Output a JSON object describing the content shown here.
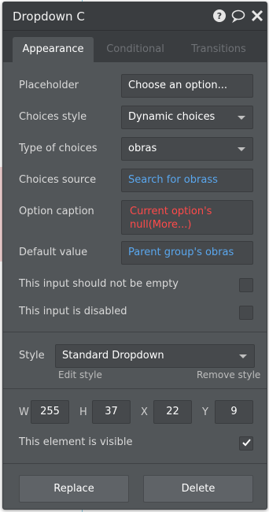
{
  "panel": {
    "title": "Dropdown C",
    "icons": [
      "help-icon",
      "comment-icon",
      "close-icon"
    ]
  },
  "tabs": [
    {
      "label": "Appearance",
      "active": true
    },
    {
      "label": "Conditional",
      "active": false
    },
    {
      "label": "Transitions",
      "active": false
    }
  ],
  "properties": {
    "placeholder": {
      "label": "Placeholder",
      "value": "Choose an option..."
    },
    "choices_style": {
      "label": "Choices style",
      "value": "Dynamic choices"
    },
    "type_of_choices": {
      "label": "Type of choices",
      "value": "obras"
    },
    "choices_source": {
      "label": "Choices source",
      "value": "Search for obrass"
    },
    "option_caption": {
      "label": "Option caption",
      "value": "Current option's null(More...)"
    },
    "default_value": {
      "label": "Default value",
      "value": "Parent group's obras"
    },
    "not_empty": {
      "label": "This input should not be empty",
      "checked": false
    },
    "disabled": {
      "label": "This input is disabled",
      "checked": false
    }
  },
  "style": {
    "label": "Style",
    "value": "Standard Dropdown",
    "edit_link": "Edit style",
    "remove_link": "Remove style"
  },
  "dimensions": {
    "w_label": "W",
    "w": "255",
    "h_label": "H",
    "h": "37",
    "x_label": "X",
    "x": "22",
    "y_label": "Y",
    "y": "9"
  },
  "visible": {
    "label": "This element is visible",
    "checked": true
  },
  "actions": {
    "replace": "Replace",
    "delete": "Delete"
  },
  "colors": {
    "panel_bg": "#525659",
    "header_bg": "#3a3d40",
    "field_bg": "#46494c",
    "link_blue": "#5aa7ee",
    "error_red": "#ff4a4a"
  }
}
